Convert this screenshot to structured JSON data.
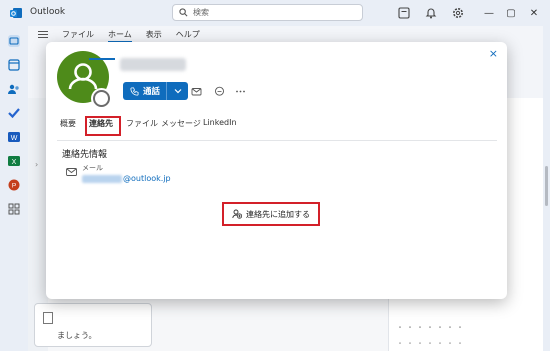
{
  "titlebar": {
    "app_name": "Outlook",
    "search_placeholder": "検索"
  },
  "menu": {
    "items": [
      "ファイル",
      "ホーム",
      "表示",
      "ヘルプ"
    ],
    "active_index": 1
  },
  "background": {
    "bottom_card_text": "ましょう。",
    "right_blurred_1": "・・・・・・・",
    "right_blurred_2": "・・・・・・・",
    "left_chevron": "›"
  },
  "contact_card": {
    "close_label": "×",
    "name_redacted": true,
    "call_button_label": "通話",
    "tabs": [
      "概要",
      "連絡先",
      "ファイル",
      "メッセージ",
      "LinkedIn"
    ],
    "selected_tab_index": 1,
    "section_title": "連絡先情報",
    "email_label": "メール",
    "email_domain": "@outlook.jp",
    "add_contact_label": "連絡先に追加する"
  },
  "colors": {
    "accent": "#0f6cbd",
    "avatar_bg": "#4e8b1a",
    "highlight_red": "#d32029"
  }
}
